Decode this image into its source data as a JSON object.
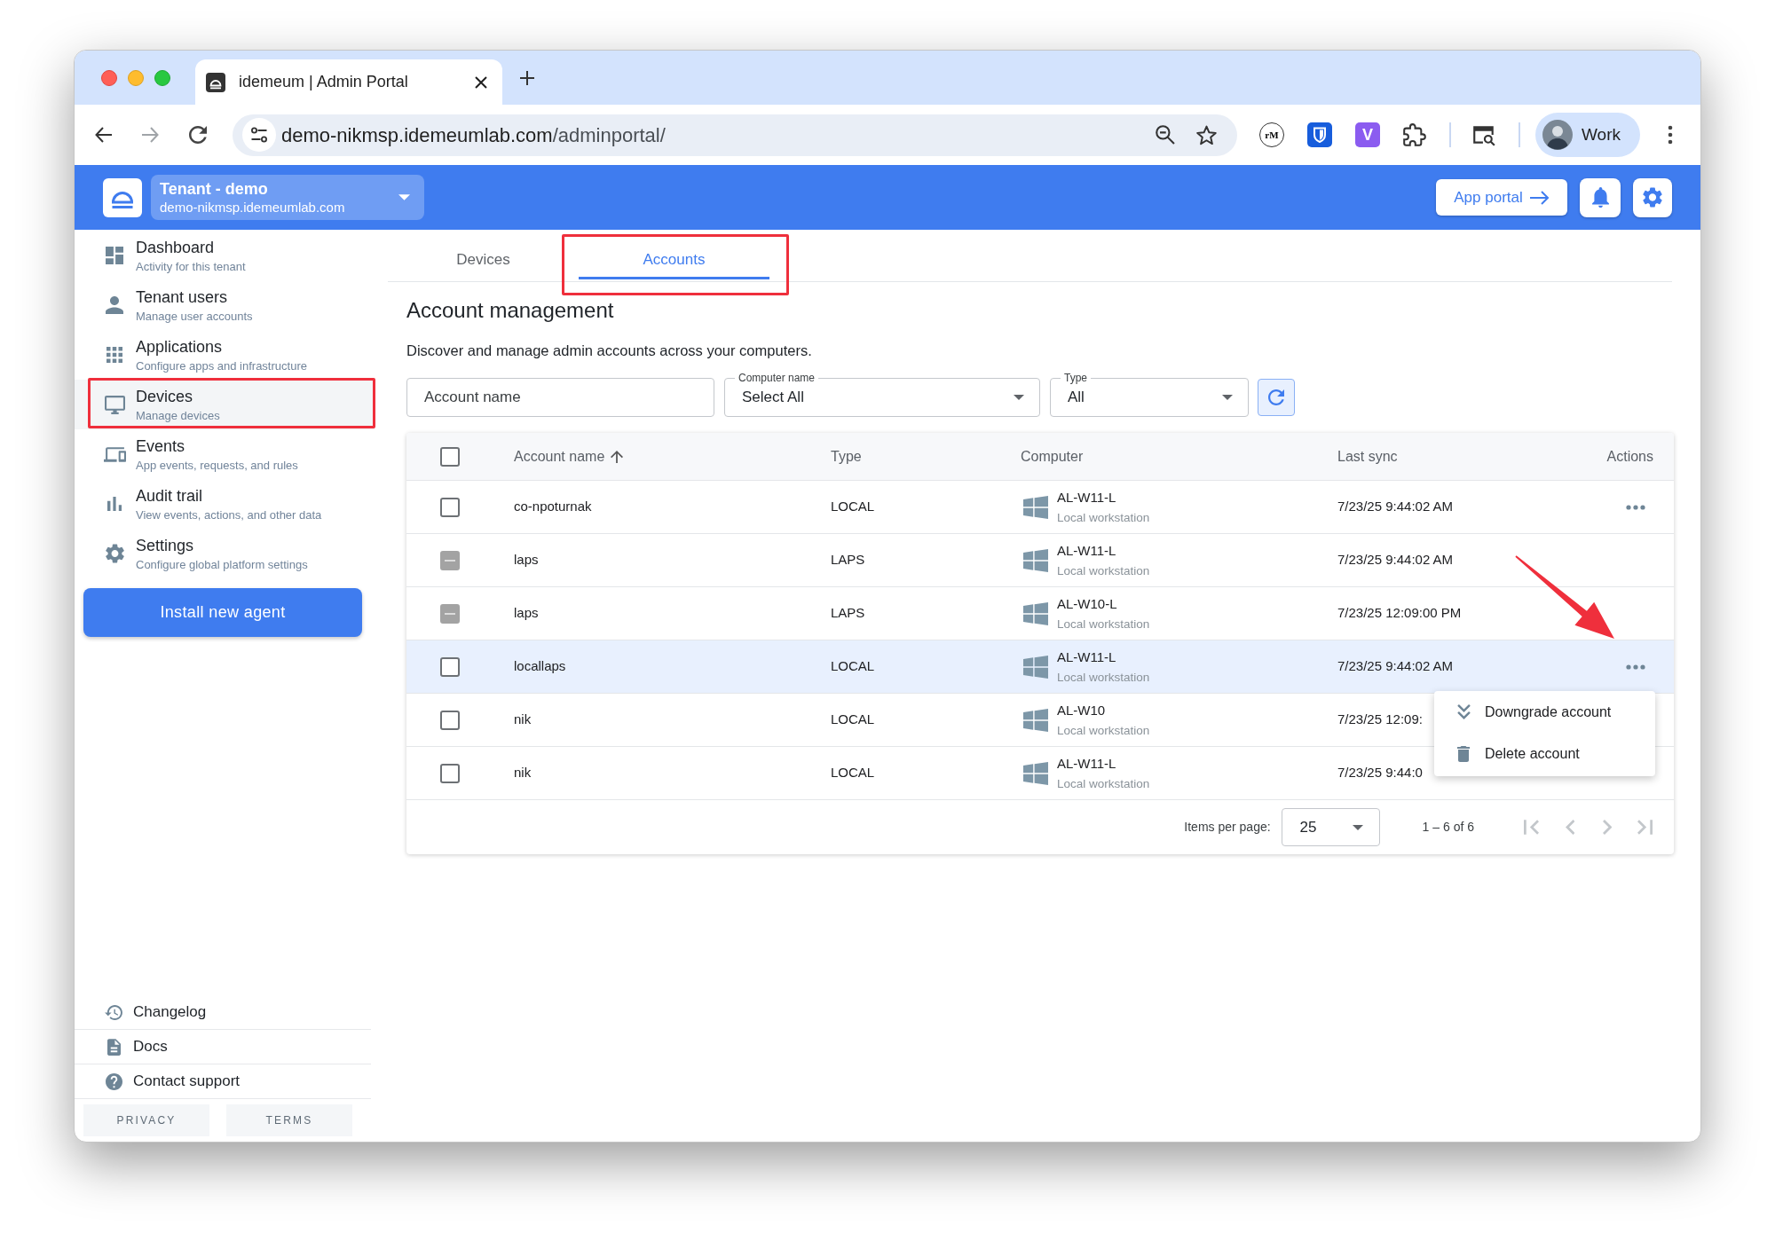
{
  "browser": {
    "tab": {
      "title": "idemeum | Admin Portal"
    },
    "url": {
      "host": "demo-nikmsp.idemeumlab.com",
      "path": "/adminportal/"
    },
    "extensions": [
      {
        "kind": "badge",
        "text": "rM"
      },
      {
        "kind": "shield"
      },
      {
        "kind": "tile",
        "text": "V"
      },
      {
        "kind": "puzzle"
      }
    ],
    "profile": {
      "label": "Work"
    }
  },
  "header": {
    "tenant": {
      "name": "Tenant - demo",
      "domain": "demo-nikmsp.idemeumlab.com"
    },
    "app_portal": "App portal"
  },
  "sidebar": {
    "items": [
      {
        "title": "Dashboard",
        "subtitle": "Activity for this tenant",
        "selected": false,
        "annotated": false
      },
      {
        "title": "Tenant users",
        "subtitle": "Manage user accounts",
        "selected": false,
        "annotated": false
      },
      {
        "title": "Applications",
        "subtitle": "Configure apps and infrastructure",
        "selected": false,
        "annotated": false
      },
      {
        "title": "Devices",
        "subtitle": "Manage devices",
        "selected": true,
        "annotated": true
      },
      {
        "title": "Events",
        "subtitle": "App events, requests, and rules",
        "selected": false,
        "annotated": false
      },
      {
        "title": "Audit trail",
        "subtitle": "View events, actions, and other data",
        "selected": false,
        "annotated": false
      },
      {
        "title": "Settings",
        "subtitle": "Configure global platform settings",
        "selected": false,
        "annotated": false
      }
    ],
    "install_button": "Install new agent",
    "links": [
      {
        "label": "Changelog"
      },
      {
        "label": "Docs"
      },
      {
        "label": "Contact support"
      }
    ],
    "footer_buttons": [
      "PRIVACY",
      "TERMS"
    ]
  },
  "tabs": [
    {
      "label": "Devices",
      "selected": false
    },
    {
      "label": "Accounts",
      "selected": true
    }
  ],
  "tab_frame": true,
  "page": {
    "title": "Account management",
    "description": "Discover and manage admin accounts across your computers."
  },
  "filters": {
    "account_name": {
      "placeholder": "Account name"
    },
    "computer_name": {
      "label": "Computer name",
      "value": "Select All"
    },
    "type": {
      "label": "Type",
      "value": "All"
    }
  },
  "table": {
    "select_all": {
      "checked": false
    },
    "columns": [
      {
        "label": "Account name",
        "sorted": true
      },
      {
        "label": "Type",
        "sorted": false
      },
      {
        "label": "Computer",
        "sorted": false
      },
      {
        "label": "Last sync",
        "sorted": false
      },
      {
        "label": "Actions",
        "sorted": false
      }
    ],
    "rows": [
      {
        "account_name": "co-npoturnak",
        "type": "LOCAL",
        "computer": "AL-W11-L",
        "computer_kind": "Local workstation",
        "last_sync": "7/23/25 9:44:02 AM",
        "checked": false,
        "disabled": false,
        "has_actions": true,
        "selected": false
      },
      {
        "account_name": "laps",
        "type": "LAPS",
        "computer": "AL-W11-L",
        "computer_kind": "Local workstation",
        "last_sync": "7/23/25 9:44:02 AM",
        "checked": false,
        "disabled": true,
        "has_actions": false,
        "selected": false
      },
      {
        "account_name": "laps",
        "type": "LAPS",
        "computer": "AL-W10-L",
        "computer_kind": "Local workstation",
        "last_sync": "7/23/25 12:09:00 PM",
        "checked": false,
        "disabled": true,
        "has_actions": false,
        "selected": false
      },
      {
        "account_name": "locallaps",
        "type": "LOCAL",
        "computer": "AL-W11-L",
        "computer_kind": "Local workstation",
        "last_sync": "7/23/25 9:44:02 AM",
        "checked": false,
        "disabled": false,
        "has_actions": true,
        "selected": true
      },
      {
        "account_name": "nik",
        "type": "LOCAL",
        "computer": "AL-W10",
        "computer_kind": "Local workstation",
        "last_sync": "7/23/25 12:09:",
        "checked": false,
        "disabled": false,
        "selected": false
      },
      {
        "account_name": "nik",
        "type": "LOCAL",
        "computer": "AL-W11-L",
        "computer_kind": "Local workstation",
        "last_sync": "7/23/25 9:44:0",
        "checked": false,
        "disabled": false,
        "selected": false
      }
    ],
    "row_menu": {
      "items": [
        {
          "label": "Downgrade account"
        },
        {
          "label": "Delete account"
        }
      ]
    },
    "annotation_arrow": true
  },
  "pagination": {
    "label": "Items per page:",
    "page_size": "25",
    "range": "1 – 6 of 6",
    "buttons": [
      {
        "disabled": true
      },
      {
        "disabled": true
      },
      {
        "disabled": true
      },
      {
        "disabled": true
      }
    ]
  }
}
